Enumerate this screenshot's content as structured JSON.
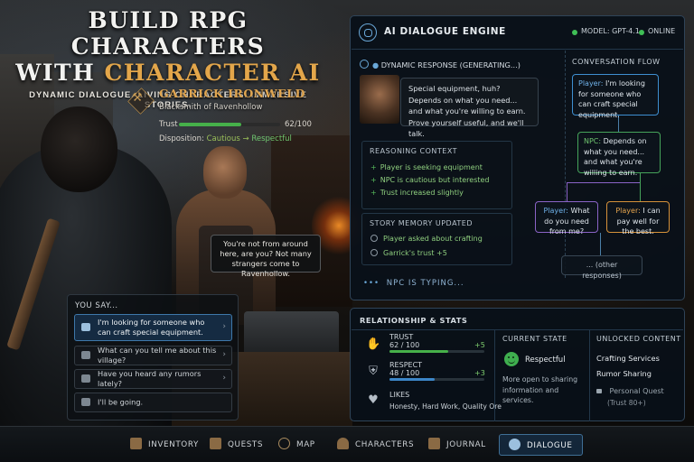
{
  "title": {
    "line1": "BUILD RPG CHARACTERS",
    "line2_part1": "WITH",
    "line2_part2": "CHARACTER AI",
    "tagline": "DYNAMIC DIALOGUE. LIVING CHARACTERS. IMMERSIVE STORIES."
  },
  "character": {
    "name": "GARRICK IRONWELD",
    "role": "Blacksmith of Ravenhollow",
    "trust_label": "Trust",
    "trust_value": "62/100",
    "trust_fraction": 0.62,
    "disposition_label": "Disposition:",
    "disposition_from": "Cautious",
    "disposition_arrow": "→",
    "disposition_to": "Respectful",
    "speech": "You're not from around here, are you? Not many strangers come to Ravenhollow."
  },
  "you_say": {
    "title": "YOU SAY...",
    "options": [
      "I'm looking for someone who can craft special equipment.",
      "What can you tell me about this village?",
      "Have you heard any rumors lately?",
      "I'll be going."
    ],
    "chevron": "›"
  },
  "ai_panel": {
    "title": "AI DIALOGUE ENGINE",
    "model": "MODEL: GPT-4.1",
    "status": "ONLINE",
    "dynamic_response_label": "DYNAMIC RESPONSE (GENERATING...)",
    "response_text": "Special equipment, huh? Depends on what you need... and what you're willing to earn. Prove yourself useful, and we'll talk.",
    "reasoning_title": "REASONING CONTEXT",
    "reasoning_items": [
      "Player is seeking equipment",
      "NPC is cautious but interested",
      "Trust increased slightly"
    ],
    "memory_title": "STORY MEMORY UPDATED",
    "memory_items": [
      "Player asked about crafting",
      "Garrick's trust +5"
    ],
    "typing": "NPC IS TYPING...",
    "typing_dots": "•••",
    "flow_title": "CONVERSATION FLOW",
    "flow": {
      "player1_who": "Player:",
      "player1_text": "I'm looking for someone who can craft special equipment.",
      "npc_who": "NPC:",
      "npc_text": "Depends on what you need... and what you're willing to earn.",
      "player2_who": "Player:",
      "player2_text": "What do you need from me?",
      "player3_who": "Player:",
      "player3_text": "I can pay well for the best.",
      "other": "... (other responses)"
    }
  },
  "relationship": {
    "title": "RELATIONSHIP & STATS",
    "trust_name": "TRUST",
    "trust_val": "62 / 100",
    "trust_fraction": 0.62,
    "trust_delta": "+5",
    "respect_name": "RESPECT",
    "respect_val": "48 / 100",
    "respect_fraction": 0.48,
    "respect_delta": "+3",
    "likes_name": "LIKES",
    "likes_val": "Honesty, Hard Work, Quality Ore",
    "current_state_title": "CURRENT STATE",
    "current_state": "Respectful",
    "current_state_desc": "More open to sharing information and services.",
    "unlocked_title": "UNLOCKED CONTENT",
    "unlocked_items": [
      "Crafting Services",
      "Rumor Sharing"
    ],
    "locked_item": "Personal Quest",
    "locked_req": "(Trust 80+)"
  },
  "nav": {
    "items": [
      "INVENTORY",
      "QUESTS",
      "MAP",
      "CHARACTERS",
      "JOURNAL",
      "DIALOGUE"
    ],
    "active": "DIALOGUE"
  },
  "colors": {
    "accent_gold": "#e3a64a",
    "accent_blue": "#3e8fd0",
    "accent_green": "#46b04a",
    "accent_purple": "#8a63c6",
    "accent_orange": "#d5913a"
  }
}
